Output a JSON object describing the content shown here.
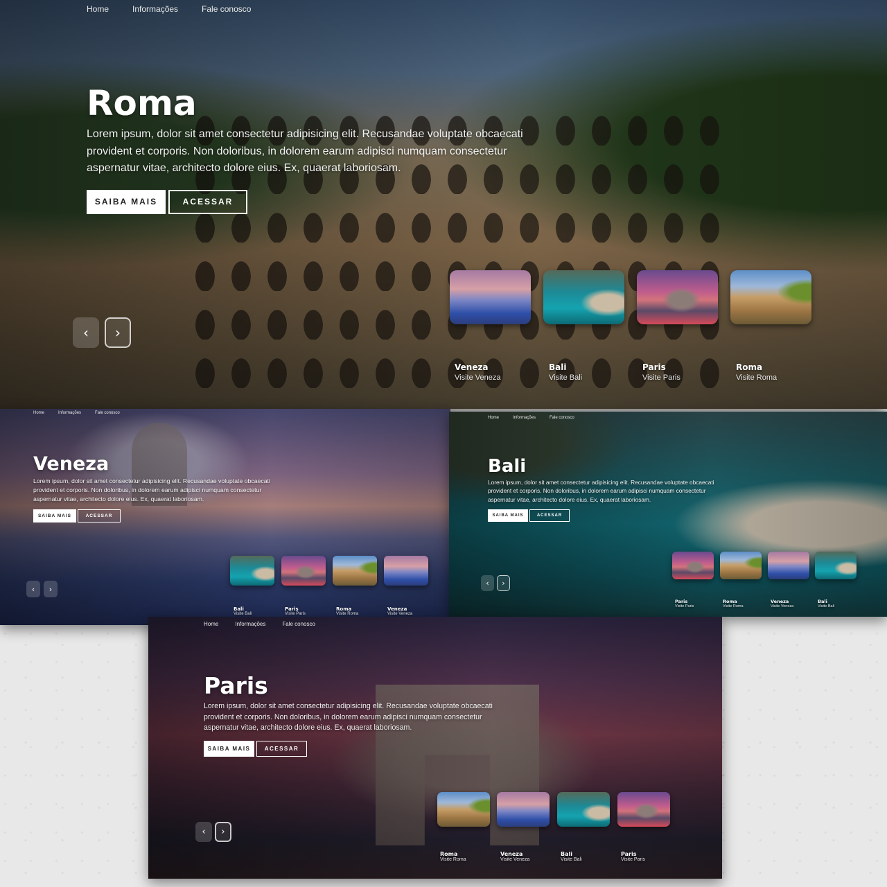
{
  "nav": [
    "Home",
    "Informações",
    "Fale conosco"
  ],
  "description": "Lorem ipsum, dolor sit amet consectetur adipisicing elit. Recusandae voluptate obcaecati provident et corporis. Non doloribus, in dolorem earum adipisci numquam consectetur aspernatur vitae, architecto dolore eius. Ex, quaerat laboriosam.",
  "buttons": {
    "primary": "SAIBA MAIS",
    "secondary": "ACESSAR"
  },
  "arrows": {
    "prev": "‹",
    "next": "›"
  },
  "slides": {
    "roma": {
      "title": "Roma",
      "thumbs": [
        {
          "title": "Veneza",
          "sub": "Visite Veneza",
          "img": "veneza"
        },
        {
          "title": "Bali",
          "sub": "Visite Bali",
          "img": "bali"
        },
        {
          "title": "Paris",
          "sub": "Visite Paris",
          "img": "paris"
        },
        {
          "title": "Roma",
          "sub": "Visite Roma",
          "img": "roma"
        }
      ]
    },
    "veneza": {
      "title": "Veneza",
      "thumbs": [
        {
          "title": "Bali",
          "sub": "Visite Bali",
          "img": "bali"
        },
        {
          "title": "Paris",
          "sub": "Visite Paris",
          "img": "paris"
        },
        {
          "title": "Roma",
          "sub": "Visite Roma",
          "img": "roma"
        },
        {
          "title": "Veneza",
          "sub": "Visite Veneza",
          "img": "veneza"
        }
      ]
    },
    "bali": {
      "title": "Bali",
      "thumbs": [
        {
          "title": "Paris",
          "sub": "Visite Paris",
          "img": "paris"
        },
        {
          "title": "Roma",
          "sub": "Visite Roma",
          "img": "roma"
        },
        {
          "title": "Veneza",
          "sub": "Visite Veneza",
          "img": "veneza"
        },
        {
          "title": "Bali",
          "sub": "Visite Bali",
          "img": "bali"
        }
      ]
    },
    "paris": {
      "title": "Paris",
      "thumbs": [
        {
          "title": "Roma",
          "sub": "Visite Roma",
          "img": "roma"
        },
        {
          "title": "Veneza",
          "sub": "Visite Veneza",
          "img": "veneza"
        },
        {
          "title": "Bali",
          "sub": "Visite Bali",
          "img": "bali"
        },
        {
          "title": "Paris",
          "sub": "Visite Paris",
          "img": "paris"
        }
      ]
    }
  }
}
